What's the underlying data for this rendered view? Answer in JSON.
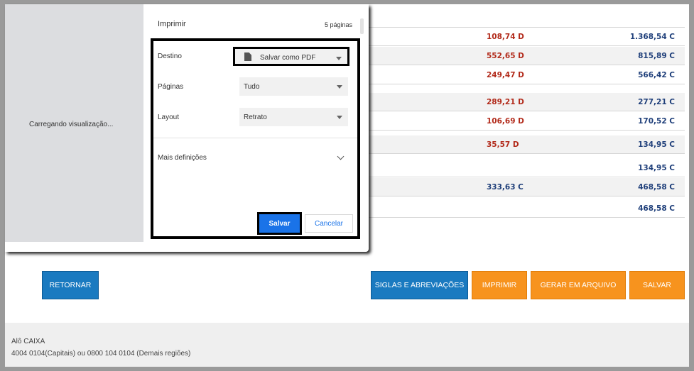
{
  "dialog": {
    "title": "Imprimir",
    "page_count": "5 páginas",
    "preview_loading": "Carregando visualização...",
    "destination_label": "Destino",
    "destination_value": "Salvar como PDF",
    "pages_label": "Páginas",
    "pages_value": "Tudo",
    "layout_label": "Layout",
    "layout_value": "Retrato",
    "more_settings": "Mais definições",
    "save_label": "Salvar",
    "cancel_label": "Cancelar"
  },
  "statement": {
    "rows": [
      {
        "debit": "108,74 D",
        "balance": "1.368,54 C"
      },
      {
        "debit": "552,65 D",
        "balance": "815,89 C"
      },
      {
        "debit": "249,47 D",
        "balance": "566,42 C"
      },
      {
        "debit": "289,21 D",
        "balance": "277,21 C"
      },
      {
        "debit": "106,69 D",
        "balance": "170,52 C"
      },
      {
        "debit": "35,57 D",
        "balance": "134,95 C"
      },
      {
        "debit": "",
        "balance": "134,95 C"
      },
      {
        "debit": "333,63 C",
        "balance": "468,58 C"
      },
      {
        "debit": "",
        "balance": "468,58 C"
      }
    ]
  },
  "actions": {
    "back": "RETORNAR",
    "abbreviations": "SIGLAS E ABREVIAÇÕES",
    "print": "IMPRIMIR",
    "file": "GERAR EM ARQUIVO",
    "save": "SALVAR"
  },
  "footer": {
    "line1": "Alô CAIXA",
    "line2": "4004 0104(Capitais) ou 0800 104 0104 (Demais regiões)"
  },
  "colors": {
    "debit": "#b22a1a",
    "balance": "#1f3f7a",
    "blue_button": "#1a7ac0",
    "orange_button": "#f7931e",
    "dialog_save": "#1a73e8"
  }
}
